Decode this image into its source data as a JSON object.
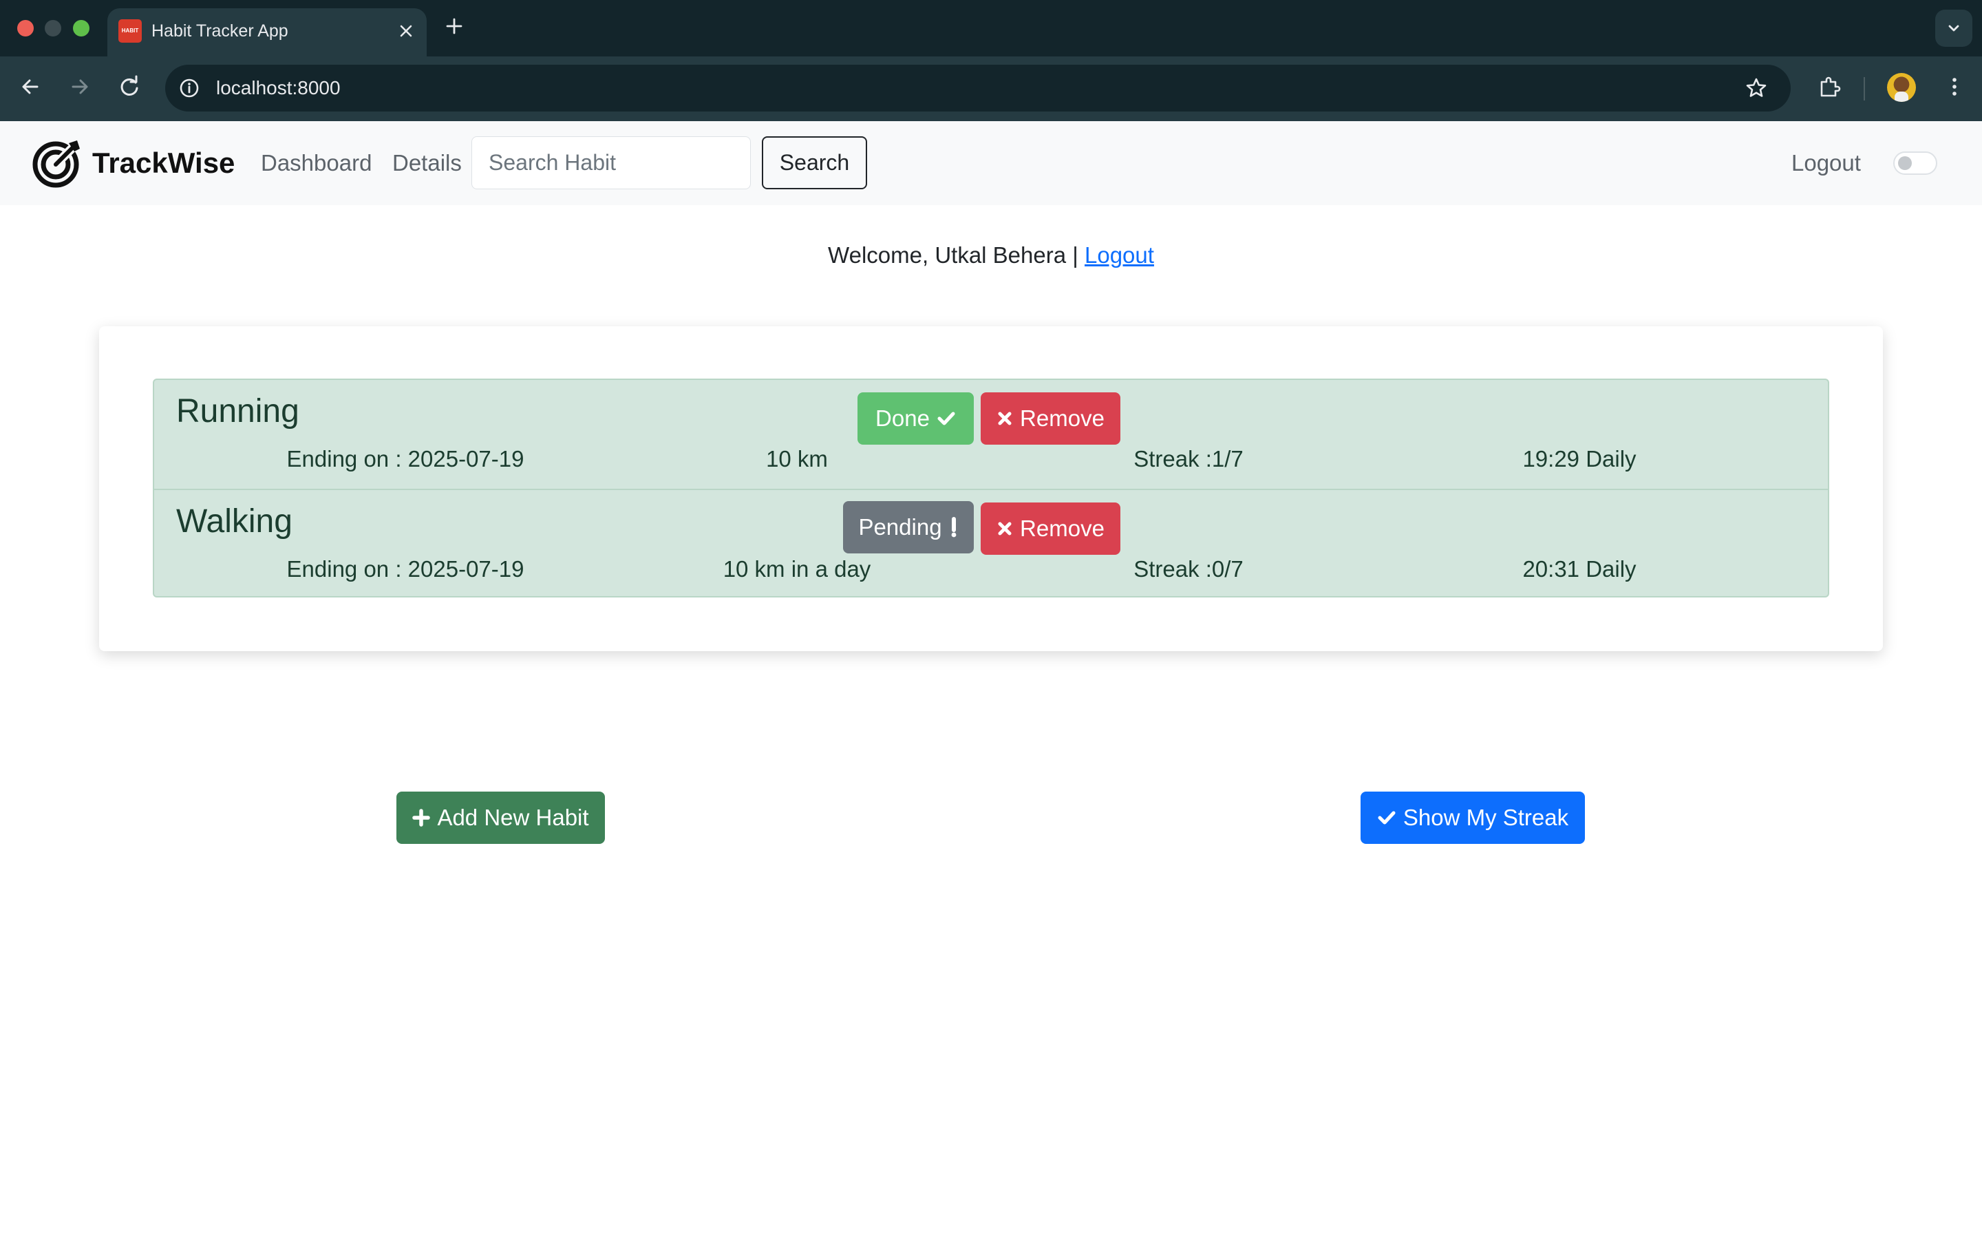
{
  "browser": {
    "tab_title": "Habit Tracker App",
    "favicon_text": "HABIT",
    "url": "localhost:8000"
  },
  "navbar": {
    "brand": "TrackWise",
    "links": [
      "Dashboard",
      "Details"
    ],
    "search_placeholder": "Search Habit",
    "search_button": "Search",
    "logout": "Logout"
  },
  "welcome": {
    "text": "Welcome, Utkal Behera |",
    "logout_link": "Logout"
  },
  "habits": [
    {
      "name": "Running",
      "ending": "Ending on : 2025-07-19",
      "goal": "10 km",
      "streak": "Streak :1/7",
      "schedule": "19:29 Daily",
      "status_label": "Done",
      "status_icon": "check-icon",
      "remove_label": "Remove"
    },
    {
      "name": "Walking",
      "ending": "Ending on : 2025-07-19",
      "goal": "10 km in a day",
      "streak": "Streak :0/7",
      "schedule": "20:31 Daily",
      "status_label": "Pending",
      "status_icon": "exclamation-icon",
      "remove_label": "Remove"
    }
  ],
  "actions": {
    "add": "Add New Habit",
    "streak": "Show My Streak"
  },
  "colors": {
    "done": "#5fc171",
    "pending": "#6c757d",
    "remove": "#d9414f",
    "add": "#3e8257",
    "streak": "#0d6efd",
    "habit_row": "#d3e6dd"
  }
}
